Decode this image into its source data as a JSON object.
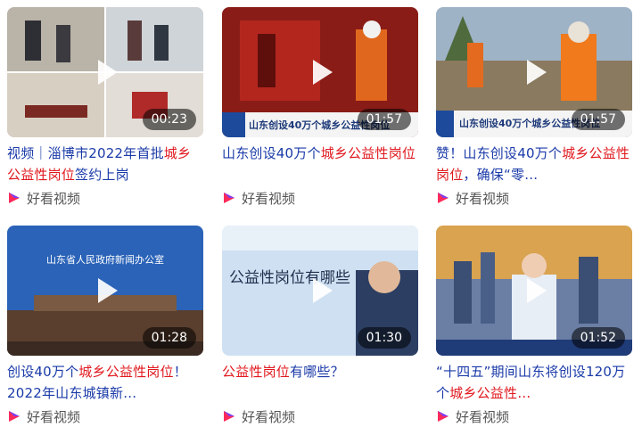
{
  "cards": [
    {
      "duration": "00:23",
      "title_parts": [
        {
          "t": "视频｜淄博市2022年首批",
          "hl": false
        },
        {
          "t": "城乡公益性岗位",
          "hl": true
        },
        {
          "t": "签约上岗",
          "hl": false
        }
      ],
      "source": "好看视频",
      "icon": "haokan-logo-icon"
    },
    {
      "duration": "01:57",
      "title_parts": [
        {
          "t": "山东创设40万个",
          "hl": false
        },
        {
          "t": "城乡公益性岗位",
          "hl": true
        }
      ],
      "source": "好看视频",
      "icon": "haokan-logo-icon",
      "overlay_text": "山东创设40万个城乡公益性岗位"
    },
    {
      "duration": "01:57",
      "title_parts": [
        {
          "t": "赞！山东创设40万个",
          "hl": false
        },
        {
          "t": "城乡公益性岗位",
          "hl": true
        },
        {
          "t": "，确保“零…",
          "hl": false
        }
      ],
      "source": "好看视频",
      "icon": "haokan-logo-icon",
      "overlay_text": "山东创设40万个城乡公益性岗位"
    },
    {
      "duration": "01:28",
      "title_parts": [
        {
          "t": "创设40万个",
          "hl": false
        },
        {
          "t": "城乡公益性岗位",
          "hl": true
        },
        {
          "t": "！2022年山东城镇新…",
          "hl": false
        }
      ],
      "source": "好看视频",
      "icon": "haokan-logo-icon",
      "overlay_text": "山东省人民政府新闻办公室"
    },
    {
      "duration": "01:30",
      "title_parts": [
        {
          "t": "公益性岗位",
          "hl": true
        },
        {
          "t": "有哪些？",
          "hl": false
        }
      ],
      "source": "好看视频",
      "icon": "haokan-logo-icon",
      "overlay_text": "公益性岗位有哪些"
    },
    {
      "duration": "01:52",
      "title_parts": [
        {
          "t": "“十四五”期间山东将创设120万个",
          "hl": false
        },
        {
          "t": "城乡公益性…",
          "hl": true
        }
      ],
      "source": "好看视频",
      "icon": "haokan-logo-icon"
    }
  ],
  "colors": {
    "highlight": "#e0181e",
    "link": "#1a0dab"
  }
}
